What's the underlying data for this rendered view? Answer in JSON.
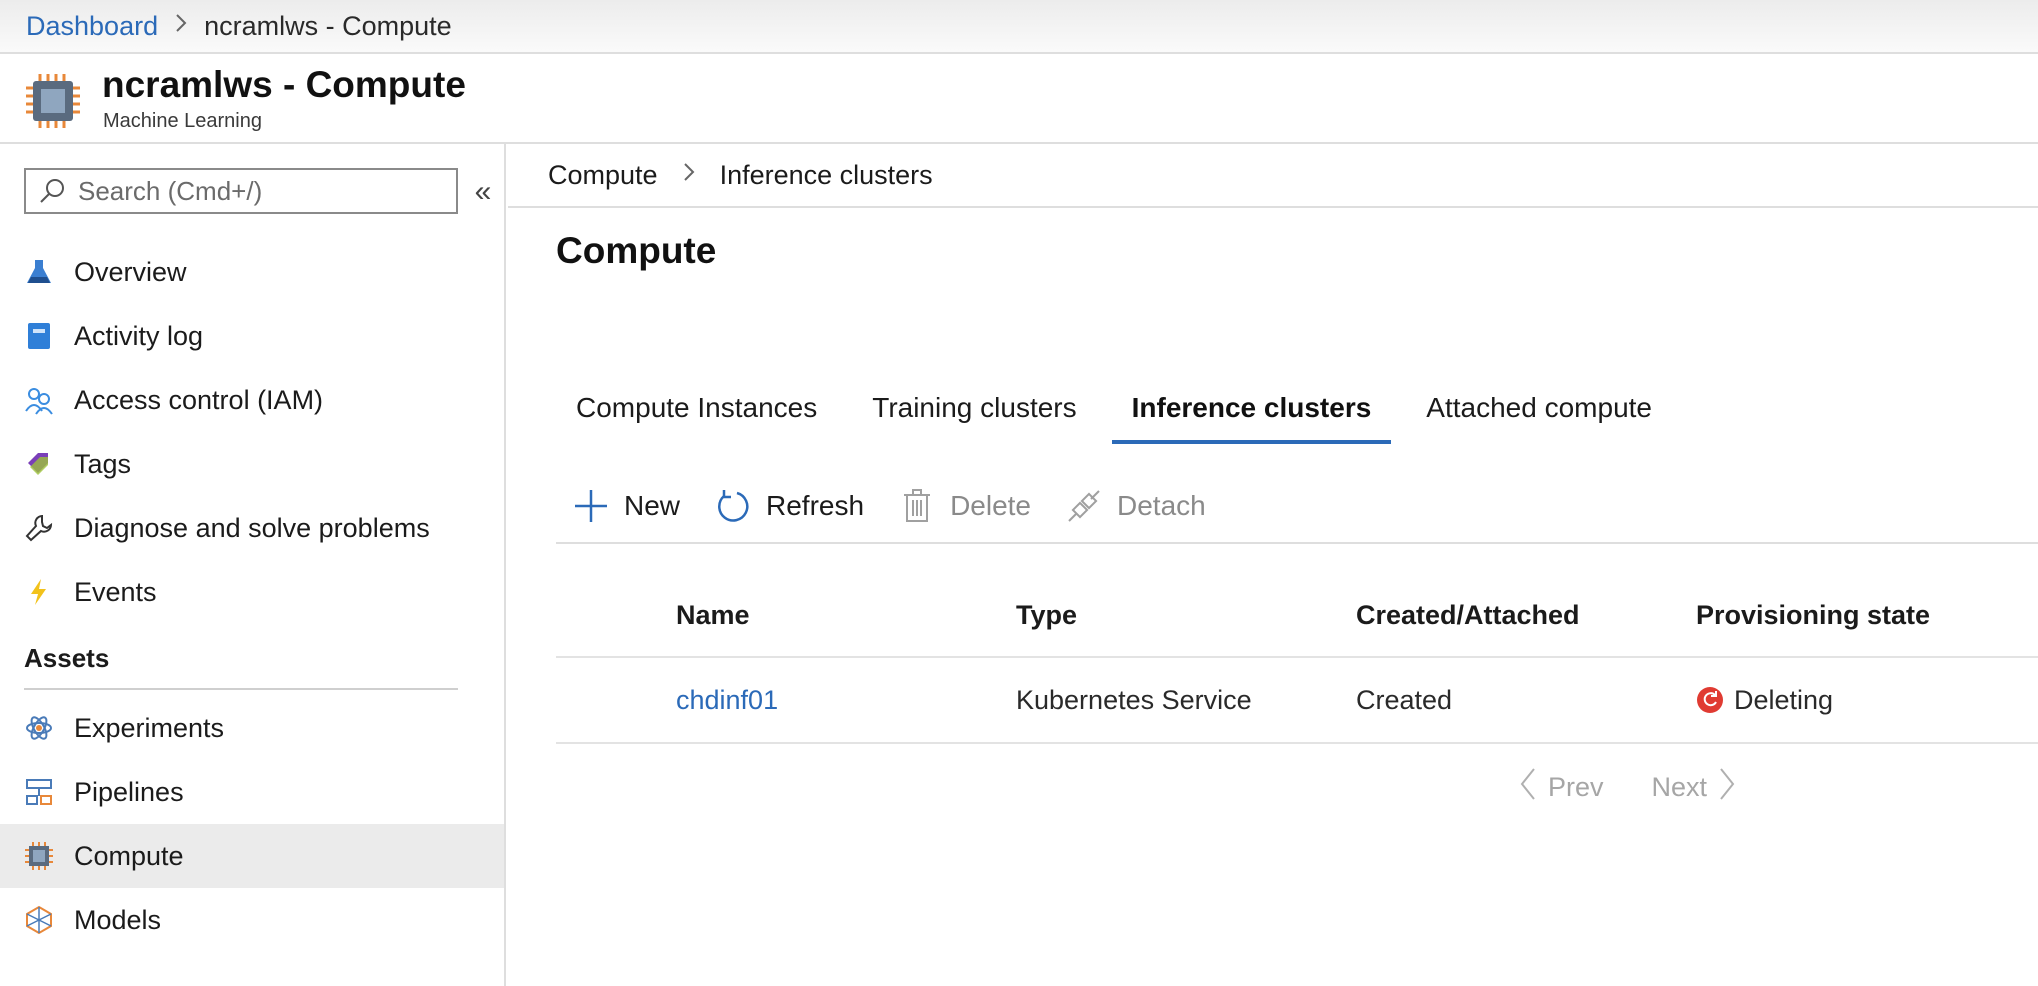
{
  "topbar": {
    "dashboard_link": "Dashboard",
    "current": "ncramlws - Compute"
  },
  "resource": {
    "title": "ncramlws - Compute",
    "subtitle": "Machine Learning"
  },
  "sidebar": {
    "search_placeholder": "Search (Cmd+/)",
    "collapse_glyph": "«",
    "items": [
      {
        "label": "Overview",
        "icon": "flask-icon"
      },
      {
        "label": "Activity log",
        "icon": "activity-log-icon"
      },
      {
        "label": "Access control (IAM)",
        "icon": "users-icon"
      },
      {
        "label": "Tags",
        "icon": "tag-icon"
      },
      {
        "label": "Diagnose and solve problems",
        "icon": "wrench-icon"
      },
      {
        "label": "Events",
        "icon": "lightning-icon"
      }
    ],
    "section_assets": "Assets",
    "asset_items": [
      {
        "label": "Experiments",
        "icon": "atom-icon"
      },
      {
        "label": "Pipelines",
        "icon": "pipeline-icon"
      },
      {
        "label": "Compute",
        "icon": "chip-icon",
        "active": true
      },
      {
        "label": "Models",
        "icon": "model-icon"
      }
    ]
  },
  "main": {
    "breadcrumb": [
      "Compute",
      "Inference clusters"
    ],
    "page_title": "Compute",
    "tabs": [
      {
        "label": "Compute Instances"
      },
      {
        "label": "Training clusters"
      },
      {
        "label": "Inference clusters",
        "active": true
      },
      {
        "label": "Attached compute"
      }
    ],
    "toolbar": {
      "new_label": "New",
      "refresh_label": "Refresh",
      "delete_label": "Delete",
      "detach_label": "Detach"
    },
    "table": {
      "headers": [
        "Name",
        "Type",
        "Created/Attached",
        "Provisioning state"
      ],
      "rows": [
        {
          "name": "chdinf01",
          "type": "Kubernetes Service",
          "created": "Created",
          "state": "Deleting"
        }
      ]
    },
    "pager": {
      "prev": "Prev",
      "next": "Next"
    }
  },
  "colors": {
    "link": "#2b6ab8",
    "accent": "#2b6ab8",
    "status_deleting": "#e03b32",
    "chip_orange": "#e8883a"
  }
}
